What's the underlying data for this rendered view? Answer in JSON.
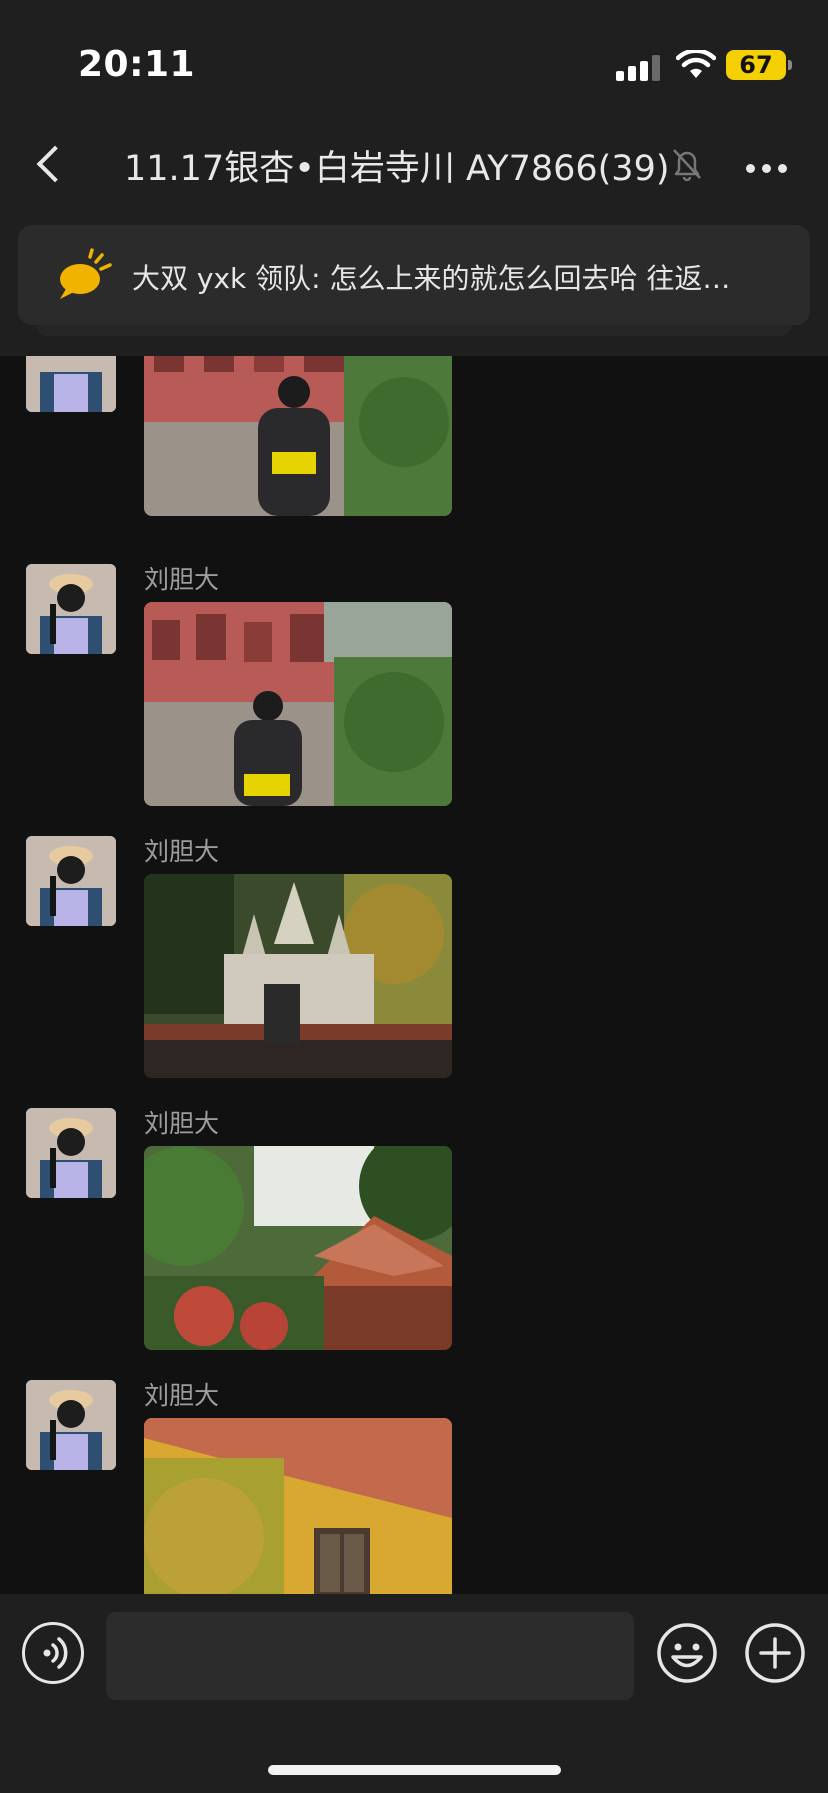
{
  "status_bar": {
    "time": "20:11",
    "battery": "67",
    "icons": [
      "cellular-signal-icon",
      "wifi-icon",
      "battery-icon"
    ]
  },
  "nav": {
    "title": "11.17银杏•白岩寺川 AY7866(39)",
    "icons": [
      "back-icon",
      "mute-bell-icon",
      "more-dots-icon"
    ]
  },
  "pinned_notice": {
    "text": "大双 yxk 领队: 怎么上来的就怎么回去哈 往返…",
    "icon": "announcement-bubble-icon",
    "icon_color": "#f0b400"
  },
  "messages": [
    {
      "sender": "",
      "photo": "temple-stairs-backpacker"
    },
    {
      "sender": "刘胆大",
      "photo": "temple-stairs-backpacker"
    },
    {
      "sender": "刘胆大",
      "photo": "white-pagoda-gate"
    },
    {
      "sender": "刘胆大",
      "photo": "red-roof-garden"
    },
    {
      "sender": "刘胆大",
      "photo": "yellow-wall-tiled-roof"
    }
  ],
  "input_bar": {
    "placeholder": "",
    "icons": [
      "voice-input-icon",
      "emoji-icon",
      "add-plus-icon"
    ]
  },
  "colors": {
    "background": "#111111",
    "bars": "#1f1f1f",
    "battery": "#f5d000",
    "sender_text": "#9d9d9d"
  }
}
